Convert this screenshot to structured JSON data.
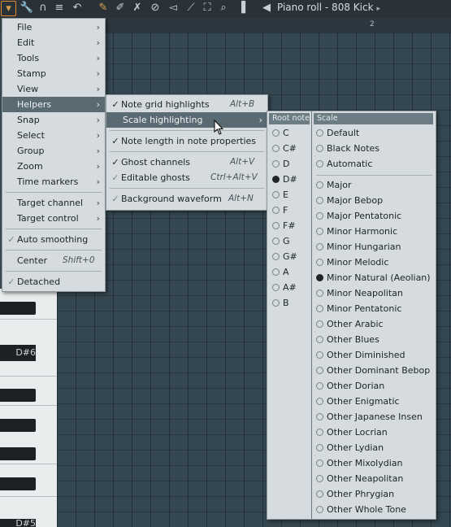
{
  "toolbar": {
    "title": "Piano roll - 808 Kick",
    "icons": [
      "menu-arrow-icon",
      "wrench-icon",
      "magnet-icon",
      "list-icon",
      "undo-icon",
      "pencil-icon",
      "paint-icon",
      "delete-icon",
      "mute-icon",
      "slice-icon",
      "select-icon",
      "zoom-icon",
      "speaker-icon",
      "play-icon"
    ]
  },
  "ruler": {
    "bar_label": "2"
  },
  "keys": {
    "label_d6": "D#6",
    "label_d5": "D#5"
  },
  "main_menu": {
    "items": [
      {
        "label": "File",
        "submenu": true
      },
      {
        "label": "Edit",
        "submenu": true
      },
      {
        "label": "Tools",
        "submenu": true
      },
      {
        "label": "Stamp",
        "submenu": true
      },
      {
        "label": "View",
        "submenu": true
      },
      {
        "label": "Helpers",
        "submenu": true,
        "highlighted": true
      },
      {
        "label": "Snap",
        "submenu": true
      },
      {
        "label": "Select",
        "submenu": true
      },
      {
        "label": "Group",
        "submenu": true
      },
      {
        "label": "Zoom",
        "submenu": true
      },
      {
        "label": "Time markers",
        "submenu": true
      },
      {
        "label": "Target channel",
        "submenu": true
      },
      {
        "label": "Target control",
        "submenu": true
      },
      {
        "label": "Auto smoothing",
        "checked": true
      },
      {
        "label": "Center",
        "shortcut": "Shift+0"
      },
      {
        "label": "Detached",
        "checked": true
      }
    ]
  },
  "helpers_menu": {
    "items": [
      {
        "label": "Note grid highlights",
        "shortcut": "Alt+B",
        "checked": true
      },
      {
        "label": "Scale highlighting",
        "submenu": true,
        "highlighted": true
      },
      {
        "label": "Note length in note properties",
        "checked": true
      },
      {
        "label": "Ghost channels",
        "shortcut": "Alt+V",
        "checked": true
      },
      {
        "label": "Editable ghosts",
        "shortcut": "Ctrl+Alt+V",
        "checked": true
      },
      {
        "label": "Background waveform",
        "shortcut": "Alt+N",
        "checked": true
      }
    ]
  },
  "scale_panel": {
    "root_header": "Root note",
    "scale_header": "Scale",
    "root_notes": [
      "C",
      "C#",
      "D",
      "D#",
      "E",
      "F",
      "F#",
      "G",
      "G#",
      "A",
      "A#",
      "B"
    ],
    "root_selected": "D#",
    "scale_options_top": [
      "Default",
      "Black Notes",
      "Automatic"
    ],
    "scales": [
      "Major",
      "Major Bebop",
      "Major Pentatonic",
      "Minor Harmonic",
      "Minor Hungarian",
      "Minor Melodic",
      "Minor Natural (Aeolian)",
      "Minor Neapolitan",
      "Minor Pentatonic",
      "Other Arabic",
      "Other Blues",
      "Other Diminished",
      "Other Dominant Bebop",
      "Other Dorian",
      "Other Enigmatic",
      "Other Japanese Insen",
      "Other Locrian",
      "Other Lydian",
      "Other Mixolydian",
      "Other Neapolitan",
      "Other Phrygian",
      "Other Whole Tone"
    ],
    "scale_selected": "Minor Natural (Aeolian)"
  },
  "colors": {
    "accent": "#e08a2c",
    "menu_bg": "#d5dbde",
    "highlight": "#5a6a72",
    "grid": "#34464f"
  }
}
